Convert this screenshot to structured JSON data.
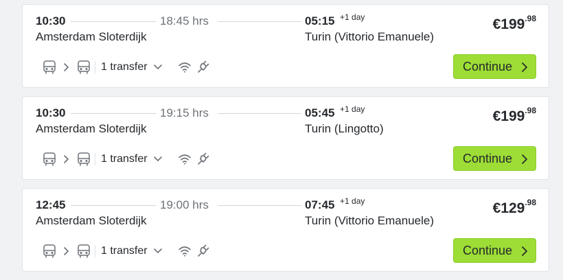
{
  "trips": [
    {
      "departure_time": "10:30",
      "duration": "18:45 hrs",
      "arrival_time": "05:15",
      "day_offset": "+1 day",
      "departure_station": "Amsterdam Sloterdijk",
      "arrival_station": "Turin (Vittorio Emanuele)",
      "price_main": "€199",
      "price_cents": ".98",
      "transfer_label": "1 transfer",
      "continue_label": "Continue"
    },
    {
      "departure_time": "10:30",
      "duration": "19:15 hrs",
      "arrival_time": "05:45",
      "day_offset": "+1 day",
      "departure_station": "Amsterdam Sloterdijk",
      "arrival_station": "Turin (Lingotto)",
      "price_main": "€199",
      "price_cents": ".98",
      "transfer_label": "1 transfer",
      "continue_label": "Continue"
    },
    {
      "departure_time": "12:45",
      "duration": "19:00 hrs",
      "arrival_time": "07:45",
      "day_offset": "+1 day",
      "departure_station": "Amsterdam Sloterdijk",
      "arrival_station": "Turin (Vittorio Emanuele)",
      "price_main": "€129",
      "price_cents": ".98",
      "transfer_label": "1 transfer",
      "continue_label": "Continue"
    }
  ],
  "icons": {
    "vehicle": "bus-icon",
    "connector": "chevron-right-icon",
    "expand": "chevron-down-icon",
    "amenity_1": "wifi-icon",
    "amenity_2": "power-plug-icon"
  },
  "colors": {
    "accent_button": "#9ddd36",
    "page_background": "#f1f2f4",
    "card_background": "#ffffff",
    "muted_text": "#6d7278"
  }
}
